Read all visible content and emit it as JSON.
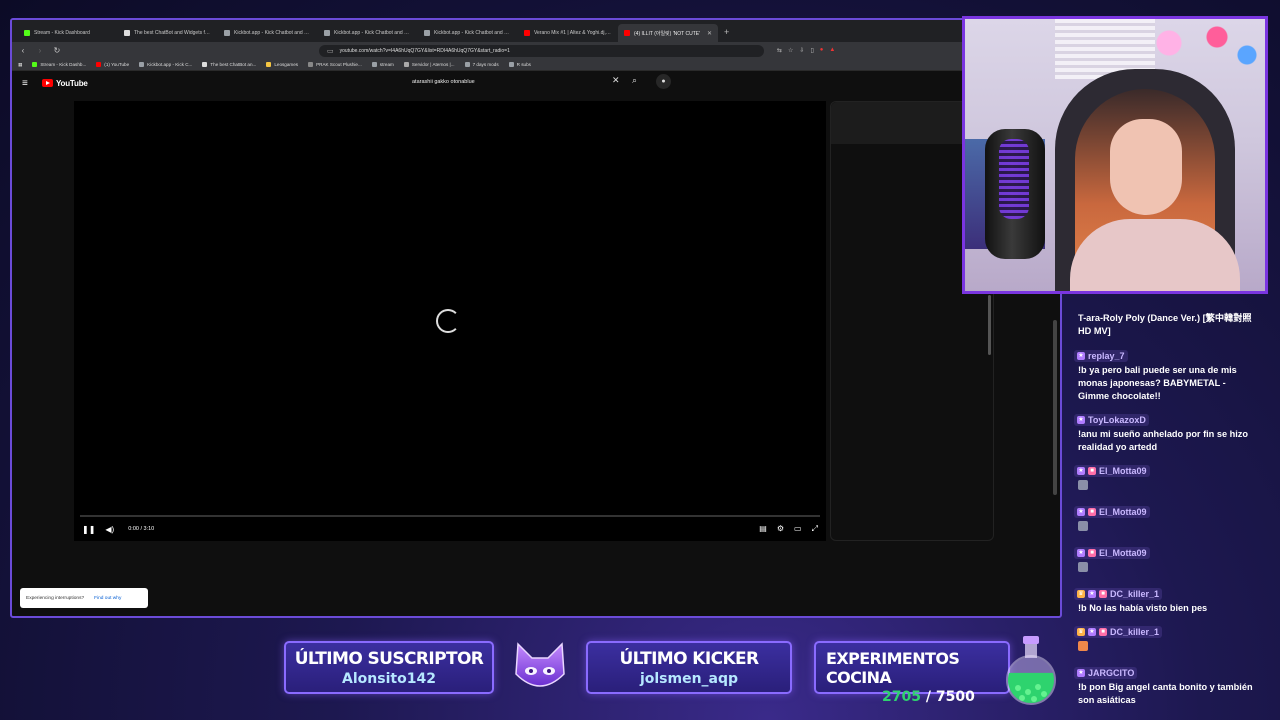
{
  "browser": {
    "tabs": [
      {
        "label": "Stream - Kick Dashboard",
        "favicon_color": "#53fc18",
        "active": false
      },
      {
        "label": "The best ChatBot and Widgets for K",
        "favicon_color": "#dddddd",
        "active": false
      },
      {
        "label": "Kickbot.app - Kick Chatbot and Overl",
        "favicon_color": "#9aa0a6",
        "active": false
      },
      {
        "label": "Kickbot.app - Kick Chatbot and Overl",
        "favicon_color": "#9aa0a6",
        "active": false
      },
      {
        "label": "Kickbot.app - Kick Chatbot and Overl",
        "favicon_color": "#9aa0a6",
        "active": false
      },
      {
        "label": "Verano Mix #1 | Altez & Yoghi.dj, Ja",
        "favicon_color": "#ff0000",
        "active": false
      },
      {
        "label": "(4) ILLIT (아일릿) 'NOT CUTE'",
        "favicon_color": "#ff0000",
        "active": true
      }
    ],
    "url": "youtube.com/watch?v=I4A6hUqQ7GY&list=RDI4A6hUqQ7GY&start_radio=1",
    "bookmarks": [
      {
        "label": "Stream - Kick Dashb...",
        "color": "#53fc18"
      },
      {
        "label": "(1) YouTube",
        "color": "#ff0000"
      },
      {
        "label": "Kickbot.app - Kick C...",
        "color": "#9aa0a6"
      },
      {
        "label": "The best ChatBot an...",
        "color": "#dddddd"
      },
      {
        "label": "Leosgames",
        "color": "#f4c542"
      },
      {
        "label": "PRAK Scout Plushie...",
        "color": "#888888"
      },
      {
        "label": "stream",
        "color": "#9aa0a6"
      },
      {
        "label": "Servidor | Aternos |...",
        "color": "#aaaaaa"
      },
      {
        "label": "7 days mods",
        "color": "#9aa0a6"
      },
      {
        "label": "R subs",
        "color": "#9aa0a6"
      }
    ]
  },
  "youtube": {
    "logo_text": "YouTube",
    "search_query": "atarashii gakko otonablue",
    "player": {
      "time": "0:00 / 3:10",
      "loading": true
    },
    "toast": {
      "text": "Experiencing interruptions?",
      "link": "Find out why"
    }
  },
  "chat": {
    "first_message": "T-ara-Roly Poly (Dance Ver.) [繁中韓對照 HD MV]",
    "messages": [
      {
        "user": "replay_7",
        "badges": [
          "b1"
        ],
        "text": "!b ya pero bali puede ser una de mis monas japonesas? BABYMETAL - Gimme chocolate!!",
        "emote": null
      },
      {
        "user": "ToyLokazoxD",
        "badges": [
          "b1"
        ],
        "text": "!anu mi sueño anhelado por fin se hizo realidad yo artedd",
        "emote": null
      },
      {
        "user": "El_Motta09",
        "badges": [
          "b1",
          "b2"
        ],
        "text": "",
        "emote": "gray"
      },
      {
        "user": "El_Motta09",
        "badges": [
          "b1",
          "b2"
        ],
        "text": "",
        "emote": "gray"
      },
      {
        "user": "El_Motta09",
        "badges": [
          "b1",
          "b2"
        ],
        "text": "",
        "emote": "gray"
      },
      {
        "user": "DC_killer_1",
        "badges": [
          "b3",
          "b1",
          "b2"
        ],
        "text": "!b No las había visto bien pes",
        "emote": null
      },
      {
        "user": "DC_killer_1",
        "badges": [
          "b3",
          "b1",
          "b2"
        ],
        "text": "",
        "emote": "orange"
      },
      {
        "user": "JARGCITO",
        "badges": [
          "b1"
        ],
        "text": "!b pon Big angel canta bonito y también son asiáticas",
        "emote": null
      }
    ]
  },
  "overlay": {
    "last_sub_title": "ÚLTIMO SUSCRIPTOR",
    "last_sub_name": "Alonsito142",
    "last_kicker_title": "ÚLTIMO KICKER",
    "last_kicker_name": "jolsmen_aqp",
    "goal_title": "EXPERIMENTOS COCINA",
    "goal_current": "2705",
    "goal_sep": " / ",
    "goal_target": "7500",
    "goal_progress": 0.36
  },
  "colors": {
    "frame_accent": "#7a35e0",
    "youtube_red": "#ff0000",
    "goal_current": "#2ed36e"
  }
}
